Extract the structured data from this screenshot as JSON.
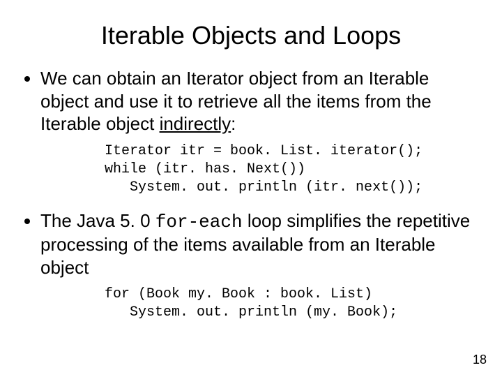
{
  "title": "Iterable Objects and Loops",
  "bullet1": {
    "pre": "We can obtain an Iterator object from an Iterable object and use it to retrieve all the items from the Iterable object ",
    "u": "indirectly",
    "post": ":"
  },
  "code1": "Iterator itr = book. List. iterator();\nwhile (itr. has. Next())\n   System. out. println (itr. next());",
  "bullet2": {
    "pre": "The Java 5. 0 ",
    "mono": "for-each",
    "post": " loop simplifies the repetitive processing of the items available from an Iterable object"
  },
  "code2": "for (Book my. Book : book. List)\n   System. out. println (my. Book);",
  "pagenum": "18"
}
